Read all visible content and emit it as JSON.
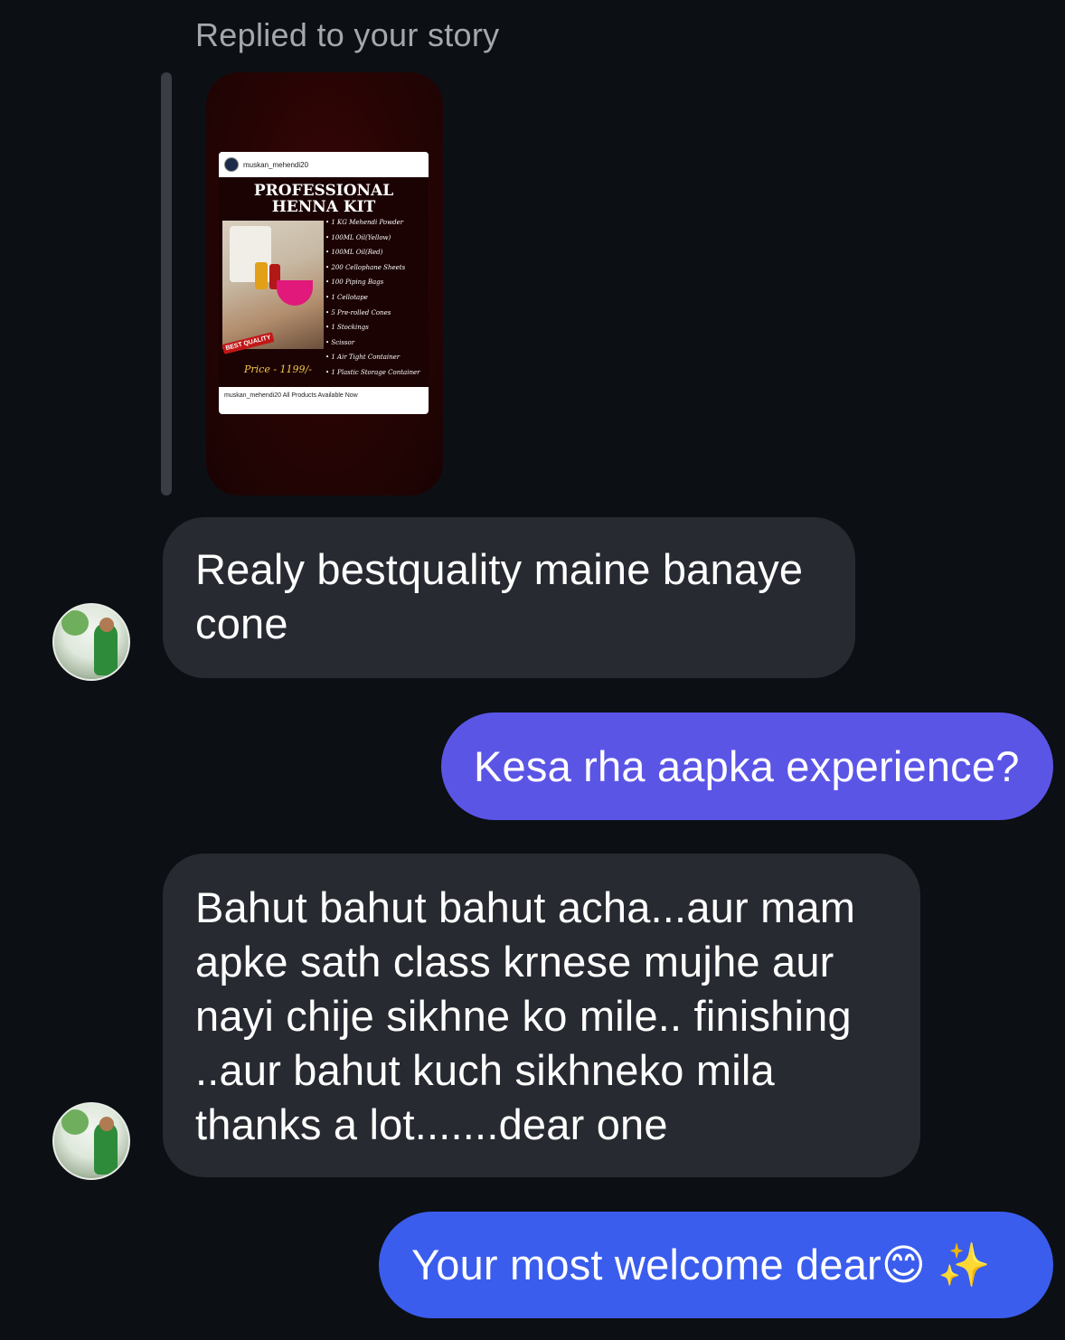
{
  "reply": {
    "caption": "Replied to your story"
  },
  "story_post": {
    "username": "muskan_mehendi20",
    "title": "PROFESSIONAL HENNA KIT",
    "items": [
      "1 KG Mehendi Powder",
      "100ML Oil(Yellow)",
      "100ML Oil(Red)",
      "200 Cellophane Sheets",
      "100 Piping Bags",
      "1 Cellotape",
      "5 Pre-rolled Cones",
      "1 Stockings",
      "Scissor",
      "1 Air Tight Container",
      "1 Plastic Storage Container"
    ],
    "badge": "BEST QUALITY",
    "price": "Price - 1199/-",
    "caption": "muskan_mehendi20 All Products Available Now"
  },
  "messages": [
    {
      "direction": "incoming",
      "text": "Realy bestquality maine banaye cone"
    },
    {
      "direction": "outgoing",
      "text": "Kesa rha aapka experience?"
    },
    {
      "direction": "incoming",
      "text": "Bahut bahut bahut acha...aur mam apke sath class krnese mujhe aur nayi chije sikhne ko mile.. finishing ..aur bahut kuch sikhneko mila thanks a lot.......dear one"
    },
    {
      "direction": "outgoing",
      "text": "Your most welcome dear😊 ✨"
    }
  ],
  "colors": {
    "background": "#0c0f14",
    "incoming_bubble": "#272a31",
    "outgoing_bubble_1": "#5b55e6",
    "outgoing_bubble_2": "#3b5ded",
    "caption_text": "#a4a7ad"
  }
}
